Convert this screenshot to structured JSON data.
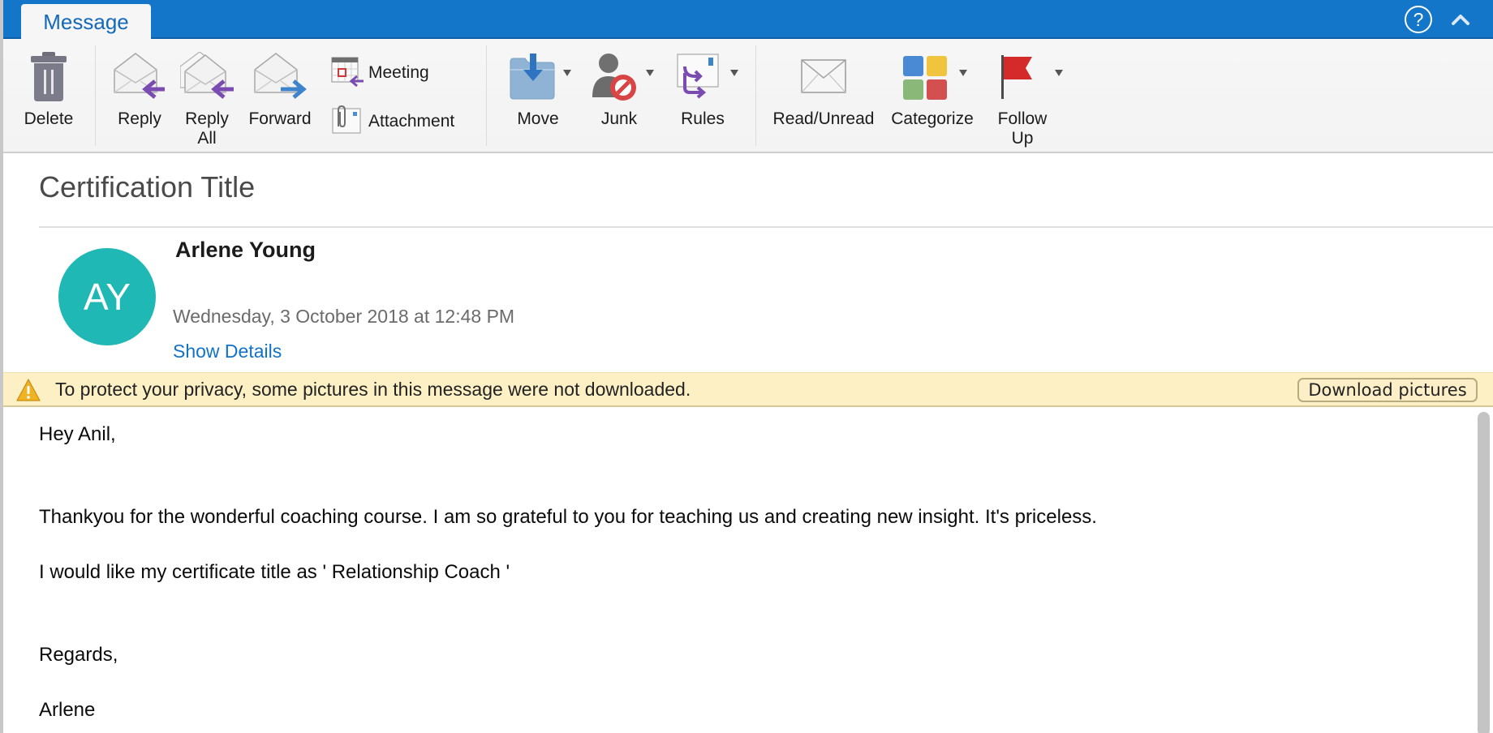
{
  "tabs": {
    "active": "Message",
    "help_label": "?"
  },
  "ribbon": {
    "delete": "Delete",
    "reply": "Reply",
    "reply_all_line1": "Reply",
    "reply_all_line2": "All",
    "forward": "Forward",
    "meeting": "Meeting",
    "attachment": "Attachment",
    "move": "Move",
    "junk": "Junk",
    "rules": "Rules",
    "read_unread": "Read/Unread",
    "categorize": "Categorize",
    "follow_up_line1": "Follow",
    "follow_up_line2": "Up"
  },
  "message": {
    "subject": "Certification Title",
    "sender_name": "Arlene Young",
    "sender_initials": "AY",
    "date": "Wednesday, 3 October 2018 at 12:48 PM",
    "show_details": "Show Details"
  },
  "banner": {
    "text": "To protect your privacy, some pictures in this message were not downloaded.",
    "button": "Download pictures"
  },
  "body": {
    "lines": [
      "Hey Anil,",
      "Thankyou for the wonderful coaching course. I am so grateful to you for teaching us and creating new insight. It's priceless.",
      "I would like my certificate title as ' Relationship Coach '",
      "Regards,",
      "Arlene"
    ]
  },
  "colors": {
    "accent": "#1476c8",
    "avatar": "#1fb8b4",
    "link": "#1172c9",
    "banner": "#fdf0c5"
  }
}
